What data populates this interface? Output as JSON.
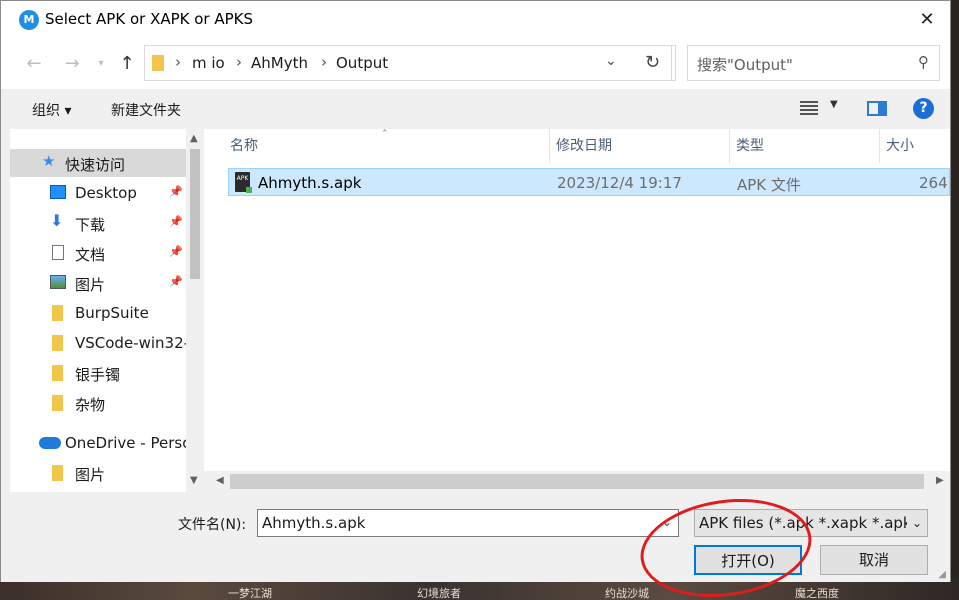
{
  "window": {
    "title": "Select APK or XAPK or APKS",
    "app_icon_text": "M"
  },
  "nav": {
    "breadcrumbs": [
      "m io",
      "AhMyth",
      "Output"
    ],
    "search_placeholder": "搜索\"Output\""
  },
  "toolbar": {
    "organize": "组织 ▾",
    "new_folder": "新建文件夹"
  },
  "sidebar": {
    "items": [
      {
        "label": "快速访问",
        "icon": "star-icon"
      },
      {
        "label": "Desktop",
        "icon": "desktop-icon"
      },
      {
        "label": "下载",
        "icon": "download-icon"
      },
      {
        "label": "文档",
        "icon": "document-icon"
      },
      {
        "label": "图片",
        "icon": "picture-icon"
      },
      {
        "label": "BurpSuite",
        "icon": "folder-icon"
      },
      {
        "label": "VSCode-win32-",
        "icon": "folder-icon"
      },
      {
        "label": "银手镯",
        "icon": "folder-icon"
      },
      {
        "label": "杂物",
        "icon": "folder-icon"
      },
      {
        "label": "OneDrive - Perso",
        "icon": "cloud-icon"
      },
      {
        "label": "图片",
        "icon": "folder-icon"
      }
    ]
  },
  "columns": {
    "name": "名称",
    "modified": "修改日期",
    "type": "类型",
    "size": "大小"
  },
  "files": [
    {
      "name": "Ahmyth.s.apk",
      "modified": "2023/12/4 19:17",
      "type": "APK 文件",
      "size": "264"
    }
  ],
  "bottom": {
    "filename_label": "文件名(N):",
    "filename_value": "Ahmyth.s.apk",
    "filter_value": "APK files (*.apk *.xapk *.apks)",
    "open_label": "打开(O)",
    "cancel_label": "取消"
  },
  "background": {
    "labels": [
      "一梦江湖",
      "幻境旅者",
      "约战沙城",
      "魔之西度"
    ]
  },
  "colors": {
    "selection": "#cce8ff",
    "accent": "#0078d7",
    "annotation": "#e01d1d"
  }
}
